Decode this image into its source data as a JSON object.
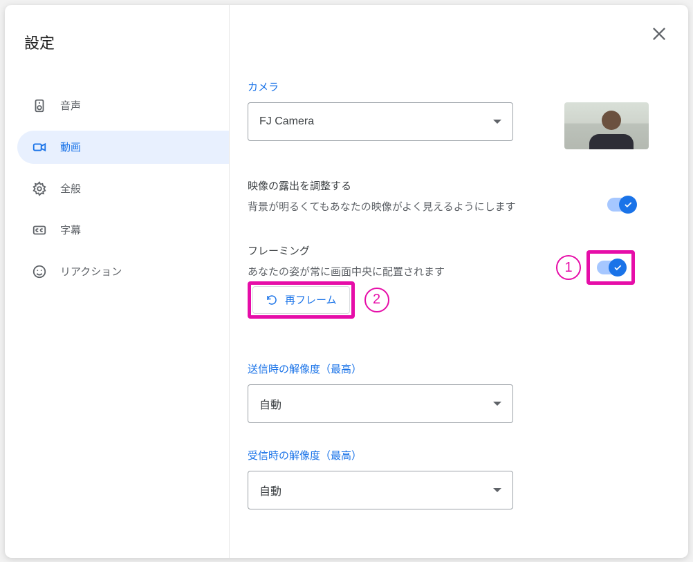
{
  "header": {
    "title": "設定"
  },
  "sidebar": {
    "items": [
      {
        "label": "音声"
      },
      {
        "label": "動画"
      },
      {
        "label": "全般"
      },
      {
        "label": "字幕"
      },
      {
        "label": "リアクション"
      }
    ]
  },
  "camera": {
    "heading": "カメラ",
    "selected": "FJ Camera"
  },
  "exposure": {
    "title": "映像の露出を調整する",
    "desc": "背景が明るくてもあなたの映像がよく見えるようにします"
  },
  "framing": {
    "title": "フレーミング",
    "desc": "あなたの姿が常に画面中央に配置されます",
    "button": "再フレーム"
  },
  "sendRes": {
    "heading": "送信時の解像度（最高）",
    "value": "自動"
  },
  "recvRes": {
    "heading": "受信時の解像度（最高）",
    "value": "自動"
  },
  "callouts": {
    "one": "1",
    "two": "2"
  }
}
